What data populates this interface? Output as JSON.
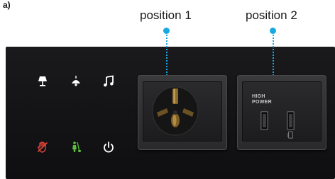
{
  "figure": {
    "panel_label": "a)"
  },
  "callouts": {
    "position_1": "position 1",
    "position_2": "position 2"
  },
  "controls": {
    "row1": [
      "desk-lamp-icon",
      "ceiling-light-icon",
      "music-note-icon"
    ],
    "row2": [
      "do-not-disturb-hand-icon",
      "make-up-room-icon",
      "power-icon"
    ]
  },
  "usb_module": {
    "label_line1": "HIGH",
    "label_line2": "POWER"
  },
  "colors": {
    "accent_blue": "#1aa8e0",
    "icon_white": "#ffffff",
    "dnd_red": "#e0453a",
    "mur_green": "#5dbb3c",
    "plate": "#141416"
  }
}
